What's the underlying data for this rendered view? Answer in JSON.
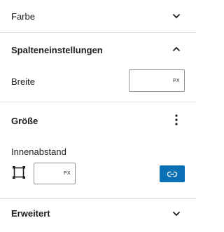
{
  "sections": {
    "farbe": {
      "title": "Farbe",
      "toggle_icon": "chevron-down-icon"
    },
    "spalten": {
      "title": "Spalteneinstellungen",
      "toggle_icon": "chevron-up-icon",
      "width": {
        "label": "Breite",
        "value": "",
        "unit": "PX"
      }
    },
    "groesse": {
      "title": "Größe",
      "menu_icon": "more-vertical-icon",
      "padding": {
        "label": "Innenabstand",
        "value": "",
        "unit": "PX",
        "sides_icon": "box-sides-icon",
        "link_icon": "link-icon",
        "accent_color": "#0a6fb5"
      }
    },
    "erweitert": {
      "title": "Erweitert",
      "toggle_icon": "chevron-down-icon"
    }
  }
}
